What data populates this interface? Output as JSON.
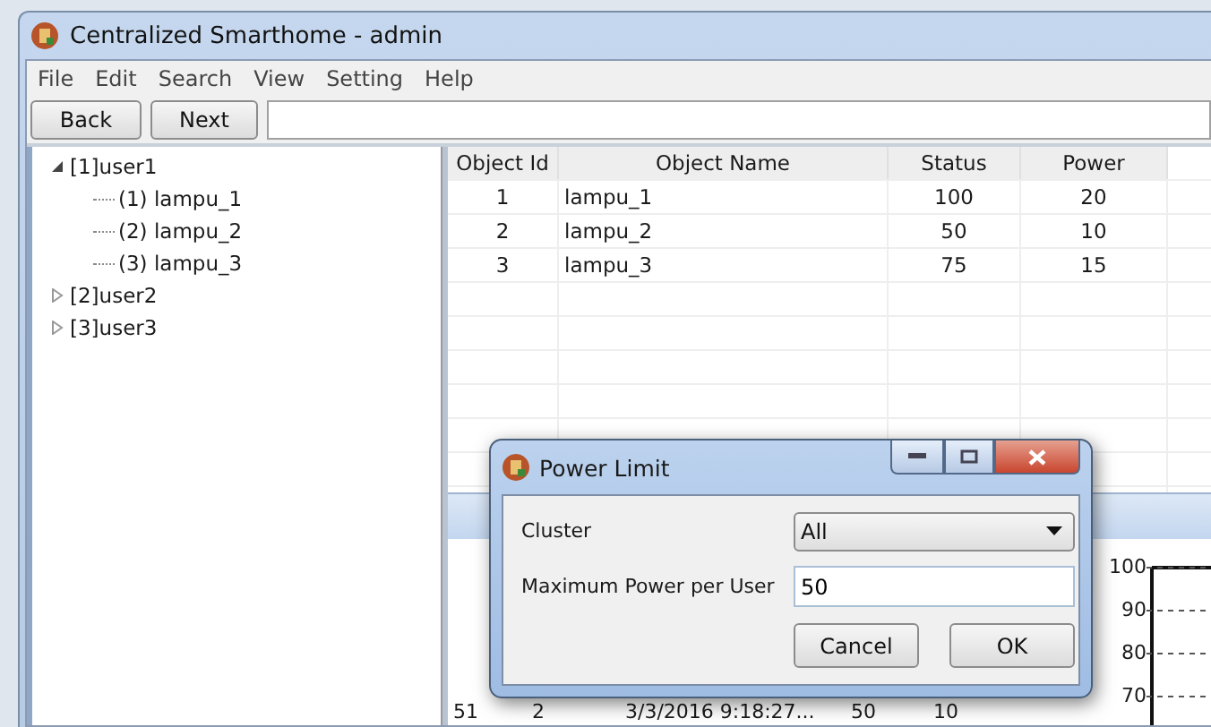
{
  "window": {
    "title": "Centralized Smarthome - admin"
  },
  "menu": [
    "File",
    "Edit",
    "Search",
    "View",
    "Setting",
    "Help"
  ],
  "toolbar": {
    "buttons": [
      "Back",
      "Next"
    ]
  },
  "tree": [
    {
      "label": "[1]user1",
      "expanded": true,
      "children": [
        {
          "label": "(1) lampu_1"
        },
        {
          "label": "(2) lampu_2"
        },
        {
          "label": "(3) lampu_3"
        }
      ]
    },
    {
      "label": "[2]user2",
      "expanded": false
    },
    {
      "label": "[3]user3",
      "expanded": false
    }
  ],
  "table": {
    "columns": [
      "Object Id",
      "Object Name",
      "Status",
      "Power"
    ],
    "rows": [
      [
        "1",
        "lampu_1",
        "100",
        "20"
      ],
      [
        "2",
        "lampu_2",
        "50",
        "10"
      ],
      [
        "3",
        "lampu_3",
        "75",
        "15"
      ]
    ]
  },
  "log_table": {
    "rows": [
      [
        "51",
        "2",
        "3/3/2016 9:18:27...",
        "50",
        "10"
      ]
    ]
  },
  "chart": {
    "yticks": [
      "100",
      "90",
      "80",
      "70"
    ]
  },
  "dialog": {
    "title": "Power Limit",
    "fields": [
      {
        "kind": "select",
        "label": "Cluster",
        "value": "All"
      },
      {
        "kind": "text",
        "label": "Maximum Power per User",
        "value": "50"
      }
    ],
    "buttons": [
      "Cancel",
      "OK"
    ]
  }
}
